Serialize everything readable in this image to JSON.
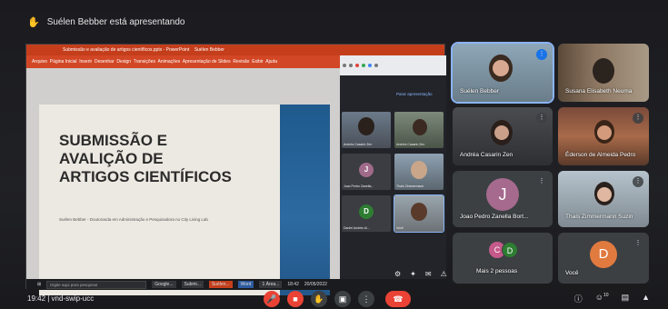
{
  "presenting_banner": {
    "text": "Suélen Bebber está apresentando"
  },
  "powerpoint": {
    "title_bar": "Submissão e avaliação de artigos científicos.pptx - PowerPoint",
    "user_name": "Suélen Bebber",
    "ribbon_tabs": [
      "Arquivo",
      "Página Inicial",
      "Inserir",
      "Desenhar",
      "Design",
      "Transições",
      "Animações",
      "Apresentação de Slides",
      "Revisão",
      "Exibir",
      "Ajuda"
    ],
    "slide": {
      "title_lines": [
        "SUBMISSÃO E",
        "AVALIÇÃO DE",
        "ARTIGOS CIENTÍFICOS"
      ],
      "subtitle": "Suélen Bebber - Doutoranda em Administração e Pesquisadora no City Living Lab"
    },
    "stop_presenting": "Parar apresentação"
  },
  "taskbar": {
    "search_placeholder": "Digite aqui para pesquisar",
    "items": [
      "Google...",
      "Submi...",
      "Suélen...",
      "Word",
      "1 Área..."
    ],
    "time": "18:42",
    "date": "20/05/2022"
  },
  "mini_tiles": [
    {
      "label": "Andréa Casarin Zen",
      "type": "photo"
    },
    {
      "label": "Andréa Casarin Zen",
      "type": "photo"
    },
    {
      "label": "Joao Pedro Zanella...",
      "type": "avatar",
      "letter": "J",
      "color": "#a06a8a"
    },
    {
      "label": "Thaís Zimmermann",
      "type": "photo"
    },
    {
      "label": "Daniel Andrés Al...",
      "type": "avatar",
      "letter": "D",
      "color": "#2e7d32"
    },
    {
      "label": "Você",
      "type": "photo"
    }
  ],
  "tiles": [
    {
      "name": "Suélen Bebber",
      "type": "photo",
      "speaking": true
    },
    {
      "name": "Susana Elisabeth Neuma",
      "type": "photo"
    },
    {
      "name": "Andréa Casarin Zen",
      "type": "photo"
    },
    {
      "name": "Éderson de Almeida Pedro",
      "type": "photo"
    },
    {
      "name": "Joao Pedro Zanella Bort...",
      "type": "avatar",
      "letter": "J",
      "color": "#a56a8d"
    },
    {
      "name": "Thaís Zimmermann Suzin",
      "type": "photo"
    },
    {
      "name": "Mais 2 pessoas",
      "type": "more",
      "letters": [
        "C",
        "D"
      ]
    },
    {
      "name": "Você",
      "type": "avatar",
      "letter": "D",
      "color": "#e07a3f"
    }
  ],
  "bottom_bar": {
    "time_meeting": "19:42  |  vnd-swip-ucc",
    "controls": [
      "mic-off",
      "camera-off",
      "raise-hand",
      "present",
      "more",
      "end-call"
    ],
    "right_icons": [
      "info",
      "people",
      "chat",
      "activities"
    ],
    "people_count": "10"
  },
  "colors": {
    "accent": "#8ab4f8",
    "danger": "#ea4335",
    "tile_bg": "#3c4043",
    "slide_bar": "#1f5a8d"
  }
}
